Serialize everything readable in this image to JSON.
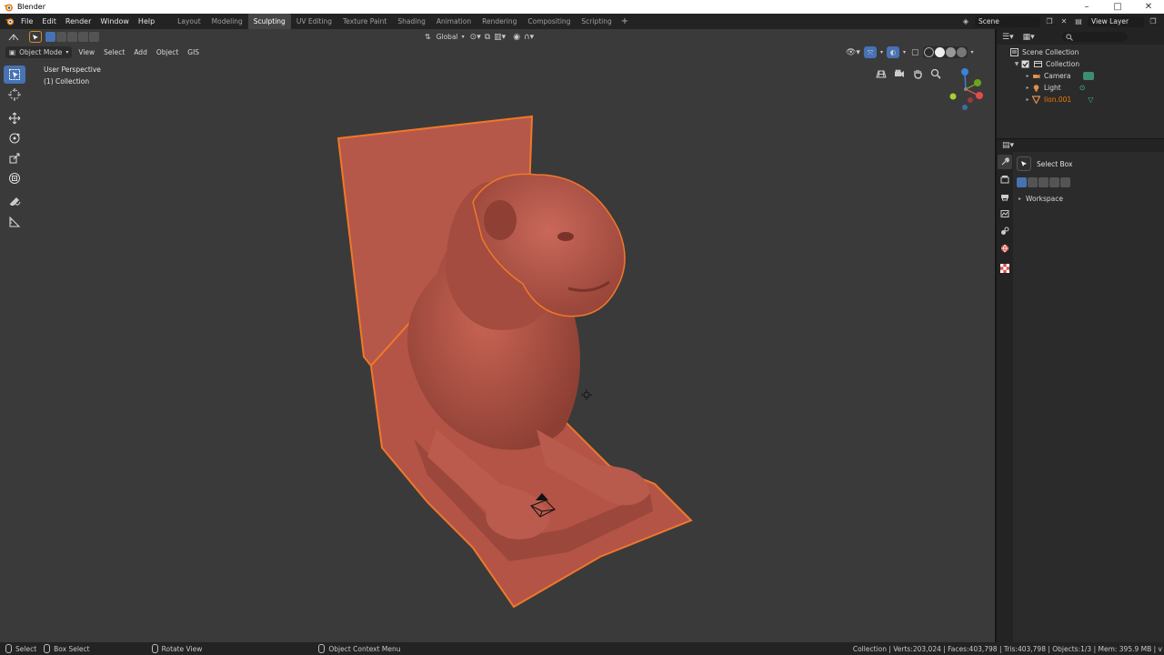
{
  "window": {
    "title": "Blender"
  },
  "menu": [
    "File",
    "Edit",
    "Render",
    "Window",
    "Help"
  ],
  "workspaces": [
    "Layout",
    "Modeling",
    "Sculpting",
    "UV Editing",
    "Texture Paint",
    "Shading",
    "Animation",
    "Rendering",
    "Compositing",
    "Scripting"
  ],
  "active_workspace": "Sculpting",
  "scene": {
    "name": "Scene",
    "view_layer": "View Layer"
  },
  "viewport_header": {
    "mode": "Object Mode",
    "menus": [
      "View",
      "Select",
      "Add",
      "Object",
      "GIS"
    ],
    "orientation": "Global"
  },
  "viewport_info": {
    "view": "User Perspective",
    "collection": "(1) Collection"
  },
  "outliner": {
    "root": "Scene Collection",
    "items": [
      {
        "label": "Collection",
        "depth": 1,
        "icon": "collection-icon"
      },
      {
        "label": "Camera",
        "depth": 2,
        "icon": "camera-icon"
      },
      {
        "label": "Light",
        "depth": 2,
        "icon": "light-icon"
      },
      {
        "label": "lion.001",
        "depth": 2,
        "icon": "mesh-icon",
        "selected": true
      }
    ]
  },
  "properties": {
    "tool_name": "Select Box",
    "panel": "Workspace"
  },
  "status_bar": {
    "items": [
      "Select",
      "Box Select",
      "Rotate View",
      "Object Context Menu"
    ],
    "stats": "Collection | Verts:203,024 | Faces:403,798 | Tris:403,798 | Objects:1/3 | Mem: 395.9 MB | v"
  },
  "colors": {
    "accent": "#4772b3",
    "selection": "#f07800",
    "model": "#b9584a",
    "model_outline": "#e8702a"
  }
}
